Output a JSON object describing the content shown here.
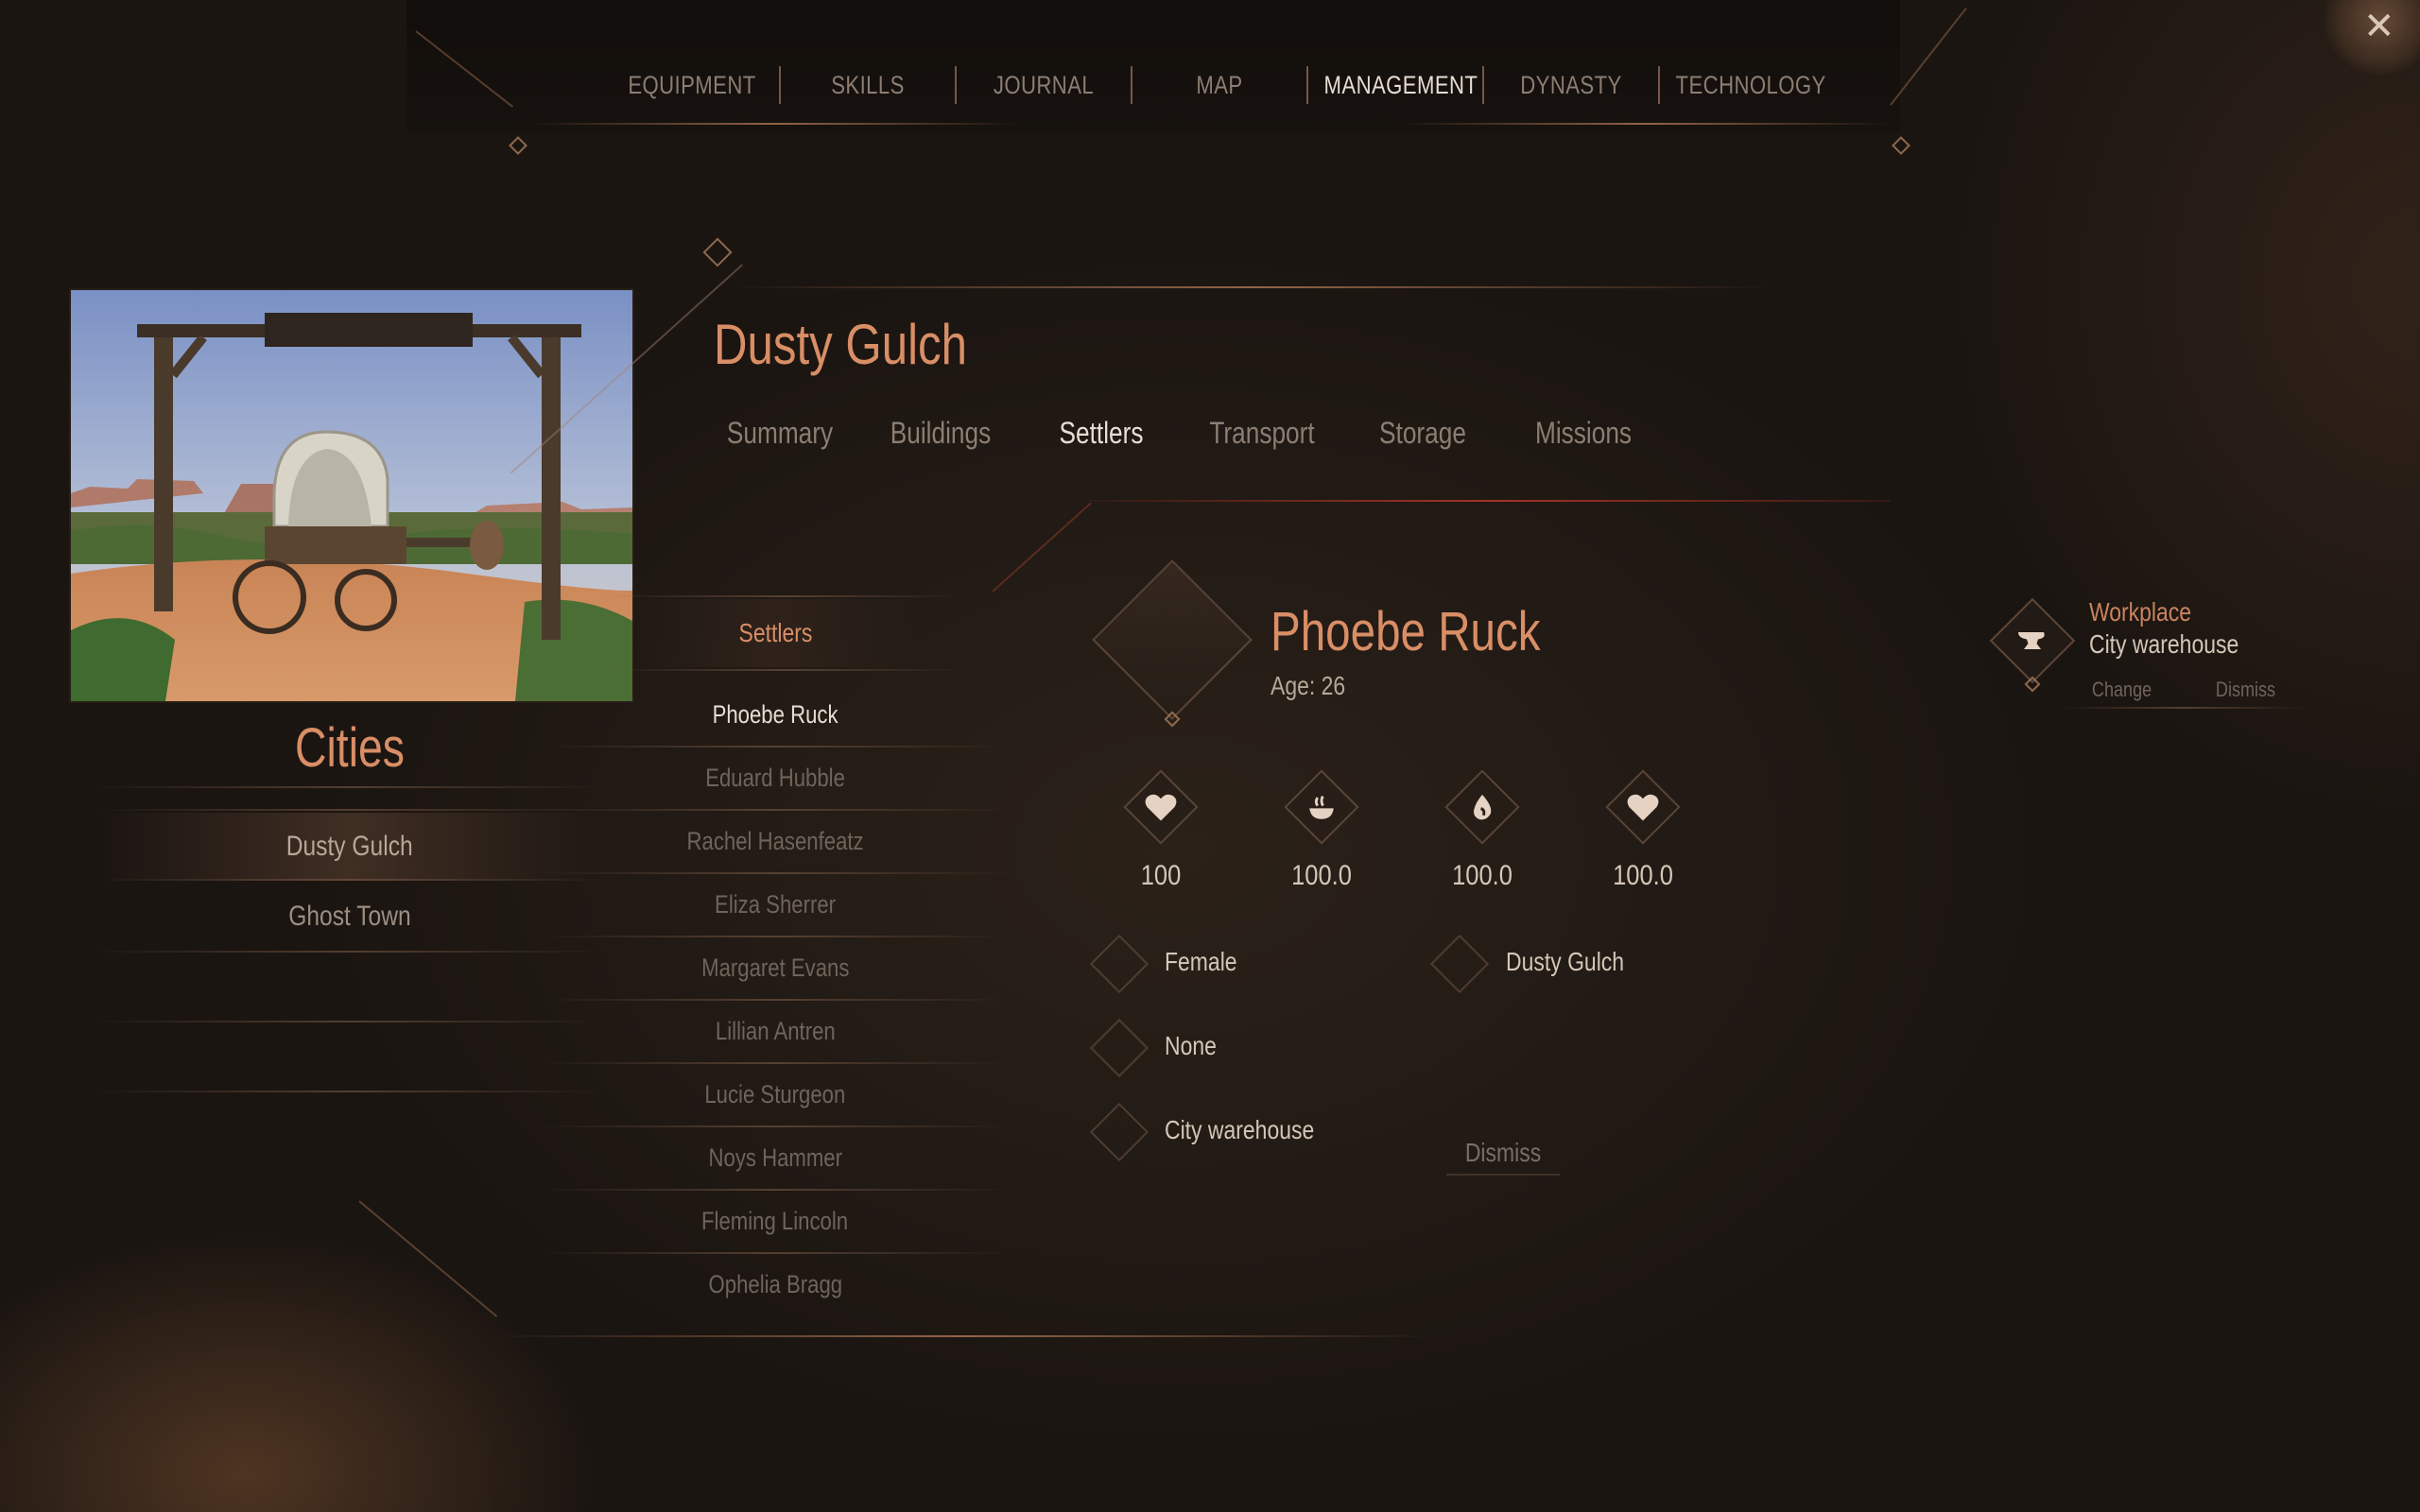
{
  "nav": {
    "tabs": [
      {
        "label": "EQUIPMENT"
      },
      {
        "label": "SKILLS"
      },
      {
        "label": "JOURNAL"
      },
      {
        "label": "MAP"
      },
      {
        "label": "MANAGEMENT"
      },
      {
        "label": "DYNASTY"
      },
      {
        "label": "TECHNOLOGY"
      }
    ],
    "active": "MANAGEMENT"
  },
  "close_icon": "close-icon",
  "cities": {
    "title": "Cities",
    "items": [
      {
        "label": "Dusty Gulch"
      },
      {
        "label": "Ghost Town"
      }
    ],
    "selected": "Dusty Gulch"
  },
  "city": {
    "name": "Dusty Gulch",
    "tabs": [
      {
        "label": "Summary"
      },
      {
        "label": "Buildings"
      },
      {
        "label": "Settlers"
      },
      {
        "label": "Transport"
      },
      {
        "label": "Storage"
      },
      {
        "label": "Missions"
      }
    ],
    "active_tab": "Settlers"
  },
  "settlers": {
    "header": "Settlers",
    "items": [
      {
        "name": "Phoebe Ruck"
      },
      {
        "name": "Eduard Hubble"
      },
      {
        "name": "Rachel Hasenfeatz"
      },
      {
        "name": "Eliza Sherrer"
      },
      {
        "name": "Margaret Evans"
      },
      {
        "name": "Lillian Antren"
      },
      {
        "name": "Lucie Sturgeon"
      },
      {
        "name": "Noys Hammer"
      },
      {
        "name": "Fleming Lincoln"
      },
      {
        "name": "Ophelia Bragg"
      }
    ],
    "selected": "Phoebe Ruck"
  },
  "detail": {
    "name": "Phoebe Ruck",
    "age": "Age: 26",
    "stats": [
      {
        "icon": "heart-icon",
        "value": "100"
      },
      {
        "icon": "food-icon",
        "value": "100.0"
      },
      {
        "icon": "water-drop-icon",
        "value": "100.0"
      },
      {
        "icon": "heart-icon",
        "value": "100.0"
      }
    ],
    "gender": "Female",
    "home_city": "Dusty Gulch",
    "relation": "None",
    "work": "City warehouse",
    "dismiss_label": "Dismiss"
  },
  "workplace": {
    "title": "Workplace",
    "value": "City warehouse",
    "icon": "anvil-icon",
    "change_label": "Change",
    "dismiss_label": "Dismiss"
  },
  "colors": {
    "accent": "#d98e66",
    "text_active": "#e8ddd2",
    "text_muted": "#8c7e72",
    "red_line": "#be3728"
  }
}
